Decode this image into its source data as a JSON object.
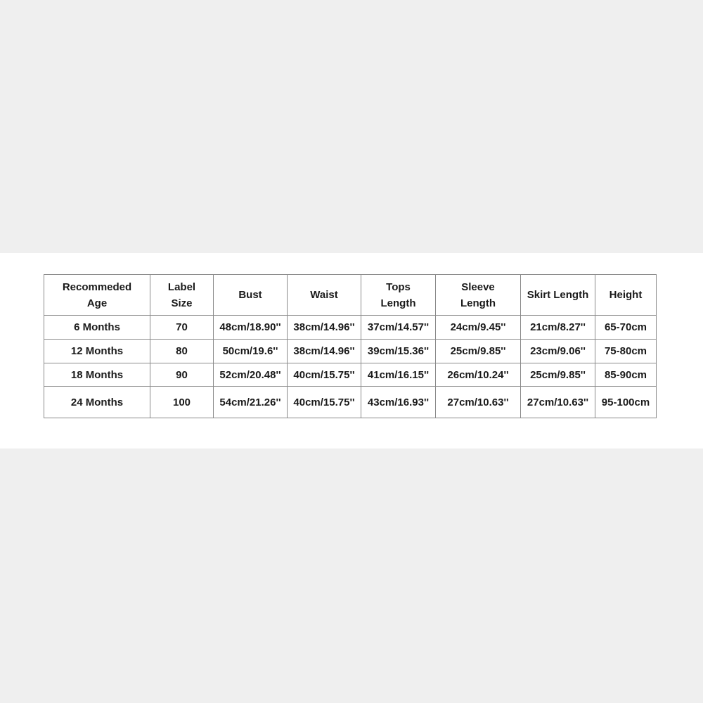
{
  "table": {
    "headers": [
      {
        "lines": [
          "Recommeded",
          "Age"
        ]
      },
      {
        "lines": [
          "Label",
          "Size"
        ]
      },
      {
        "lines": [
          "Bust"
        ]
      },
      {
        "lines": [
          "Waist"
        ]
      },
      {
        "lines": [
          "Tops",
          "Length"
        ]
      },
      {
        "lines": [
          "Sleeve",
          "Length"
        ]
      },
      {
        "lines": [
          "Skirt Length"
        ]
      },
      {
        "lines": [
          "Height"
        ]
      }
    ],
    "rows": [
      [
        "6 Months",
        "70",
        "48cm/18.90''",
        "38cm/14.96''",
        "37cm/14.57''",
        "24cm/9.45''",
        "21cm/8.27''",
        "65-70cm"
      ],
      [
        "12 Months",
        "80",
        "50cm/19.6''",
        "38cm/14.96''",
        "39cm/15.36''",
        "25cm/9.85''",
        "23cm/9.06''",
        "75-80cm"
      ],
      [
        "18 Months",
        "90",
        "52cm/20.48''",
        "40cm/15.75''",
        "41cm/16.15''",
        "26cm/10.24''",
        "25cm/9.85''",
        "85-90cm"
      ],
      [
        "24 Months",
        "100",
        "54cm/21.26''",
        "40cm/15.75''",
        "43cm/16.93''",
        "27cm/10.63''",
        "27cm/10.63''",
        "95-100cm"
      ]
    ]
  }
}
